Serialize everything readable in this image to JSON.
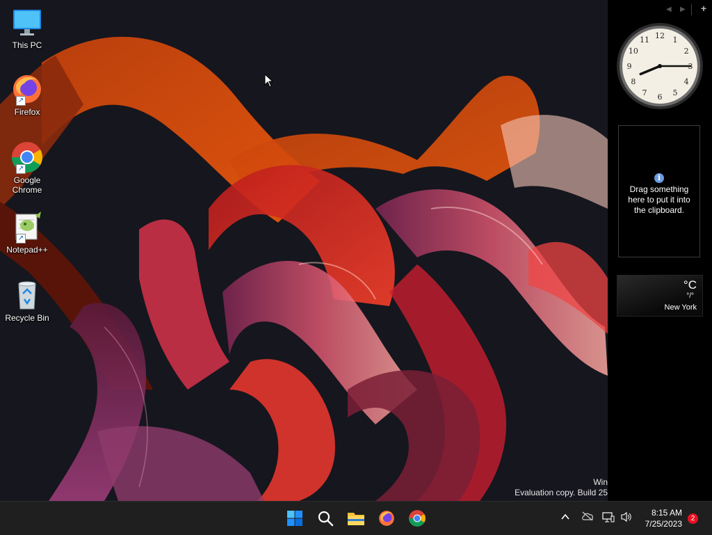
{
  "desktop": {
    "icons": [
      {
        "label": "This PC",
        "icon": "computer-icon"
      },
      {
        "label": "Firefox",
        "icon": "firefox-icon"
      },
      {
        "label": "Google Chrome",
        "icon": "chrome-icon"
      },
      {
        "label": "Notepad++",
        "icon": "notepadpp-icon"
      },
      {
        "label": "Recycle Bin",
        "icon": "recycle-bin-icon"
      }
    ],
    "watermark": {
      "line1": "Win",
      "line2": "Evaluation copy. Build 25"
    }
  },
  "sidebar": {
    "controls": {
      "prev": "◀",
      "next": "▶",
      "add": "+"
    },
    "clock": {
      "hour": 8,
      "minute": 15,
      "numerals": [
        "12",
        "1",
        "2",
        "3",
        "4",
        "5",
        "6",
        "7",
        "8",
        "9",
        "10",
        "11"
      ]
    },
    "clipboard": {
      "icon_char": "i",
      "message": "Drag something here to put it into the clipboard."
    },
    "weather": {
      "temp": "°C",
      "range": "°/°",
      "city": "New York"
    }
  },
  "taskbar": {
    "apps": [
      "start-icon",
      "search-icon",
      "file-explorer-icon",
      "firefox-icon",
      "chrome-icon"
    ],
    "tray": {
      "overflow": "^"
    },
    "time": "8:15 AM",
    "date": "7/25/2023",
    "notifications": "2"
  },
  "colors": {
    "taskbar_bg": "#1f1f1f",
    "sidebar_bg": "#000000",
    "notification_badge": "#e81123",
    "start_blue": "#0a84ff"
  }
}
